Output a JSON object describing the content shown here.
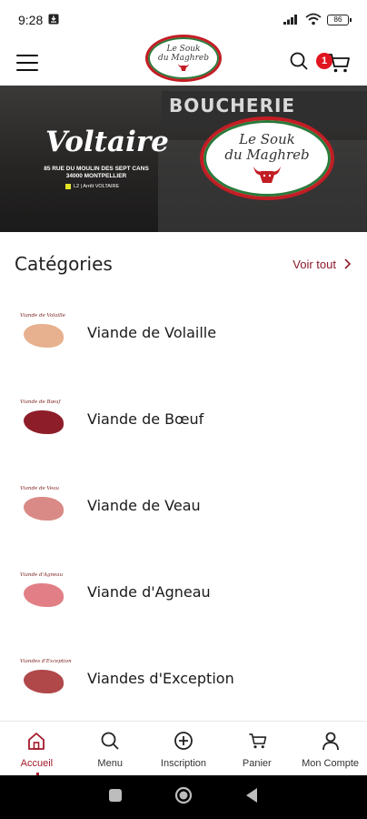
{
  "status_bar": {
    "time": "9:28",
    "battery": "86"
  },
  "header": {
    "logo_line1": "Le Souk",
    "logo_line2": "du Maghreb",
    "cart_count": "1"
  },
  "banner": {
    "sign_text": "BOUCHERIE",
    "title": "Voltaire",
    "address_line1": "85 RUE DU MOULIN DES SEPT CANS",
    "address_line2": "34000 MONTPELLIER",
    "metro": "L2 | Arrêt VOLTAIRE",
    "logo_line1": "Le Souk",
    "logo_line2": "du Maghreb"
  },
  "categories": {
    "title": "Catégories",
    "see_all": "Voir tout",
    "items": [
      {
        "label": "Viande de Volaille",
        "caption": "Viande de Volaille",
        "color": "#e7b08e"
      },
      {
        "label": "Viande de Bœuf",
        "caption": "Viande de Bœuf",
        "color": "#8e1d2a"
      },
      {
        "label": "Viande de Veau",
        "caption": "Viande de Veau",
        "color": "#d98a86"
      },
      {
        "label": "Viande d'Agneau",
        "caption": "Viande d'Agneau",
        "color": "#e27f86"
      },
      {
        "label": "Viandes d'Exception",
        "caption": "Viandes d'Exception",
        "color": "#b0484a"
      }
    ]
  },
  "bottom_nav": {
    "items": [
      {
        "label": "Accueil",
        "icon": "home-icon"
      },
      {
        "label": "Menu",
        "icon": "search-icon"
      },
      {
        "label": "Inscription",
        "icon": "plus-circle-icon"
      },
      {
        "label": "Panier",
        "icon": "cart-icon"
      },
      {
        "label": "Mon Compte",
        "icon": "user-icon"
      }
    ]
  },
  "colors": {
    "accent": "#a2192a",
    "badge": "#e0151f",
    "logo_red": "#c31d24",
    "logo_green": "#2a7a3b"
  }
}
